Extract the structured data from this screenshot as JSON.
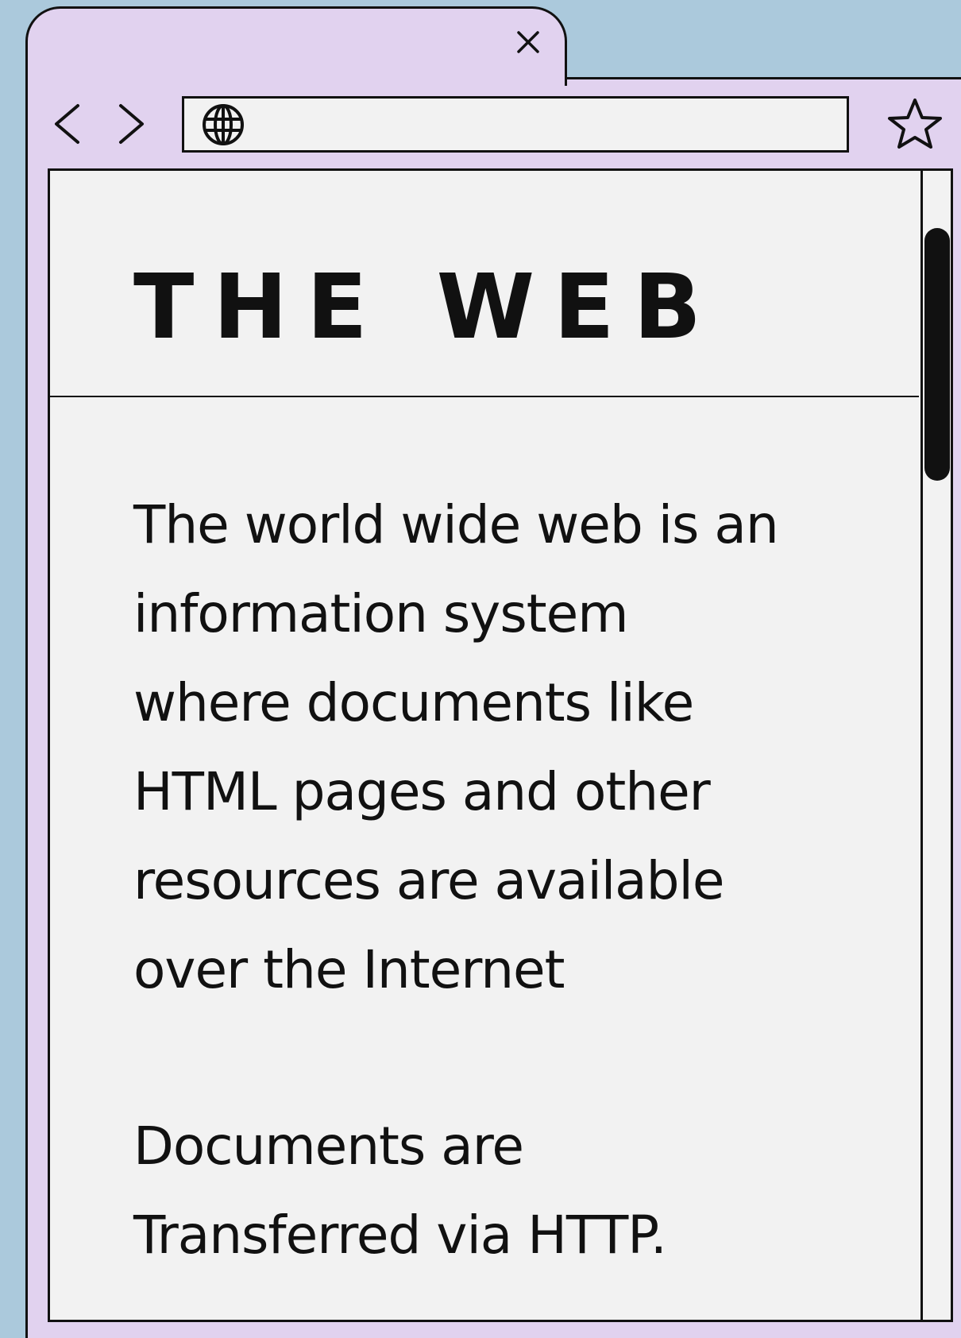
{
  "window": {
    "address_bar": {
      "value": "",
      "placeholder": ""
    }
  },
  "page": {
    "title": "THE WEB",
    "paragraphs": [
      "The world wide web is an\ninformation system\nwhere documents like\nHTML pages and other\nresources are available\nover the Internet",
      "Documents are\nTransferred via HTTP."
    ]
  },
  "scrollbar": {
    "position_fraction": 0.0,
    "visible_fraction": 0.25
  },
  "icons": {
    "tab_close": "close-icon",
    "back": "chevron-left-icon",
    "forward": "chevron-right-icon",
    "address": "globe-icon",
    "bookmark": "star-icon"
  },
  "colors": {
    "background": "#abc9dc",
    "chrome": "#e1d2ef",
    "page": "#f2f2f2",
    "ink": "#111111"
  }
}
